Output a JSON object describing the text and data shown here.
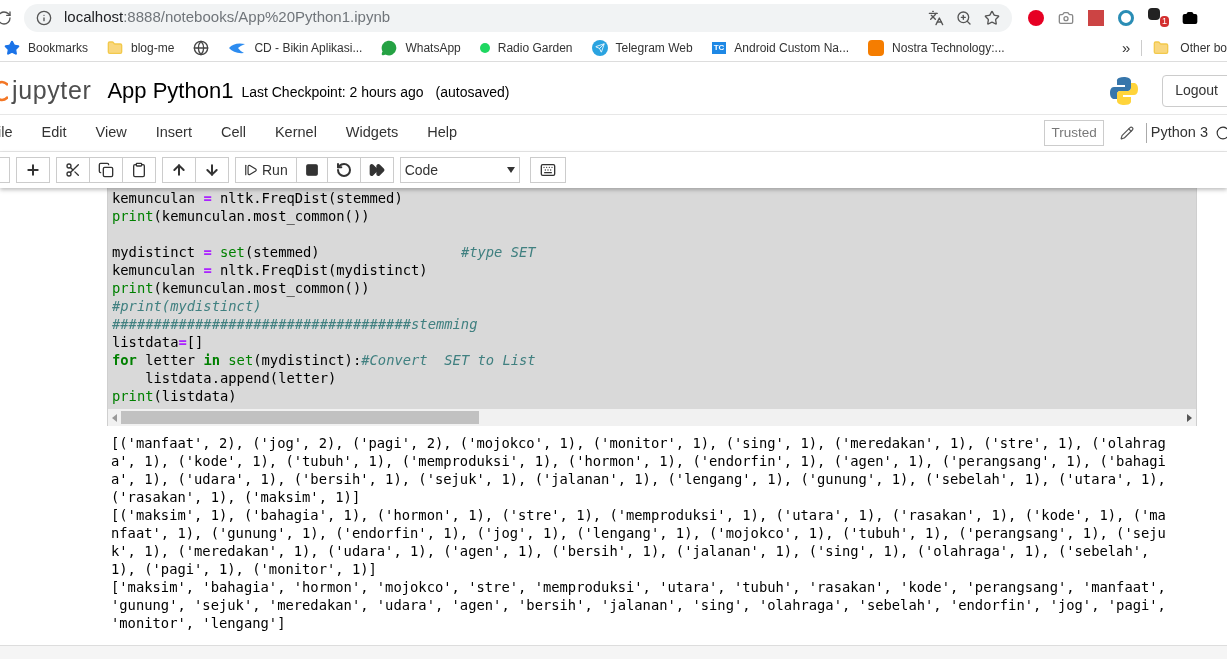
{
  "browser": {
    "url_host": "localhost",
    "url_path": ":8888/notebooks/App%20Python1.ipynb",
    "extension_badge": "1",
    "bookmarks": [
      {
        "label": "Bookmarks",
        "kind": "star"
      },
      {
        "label": "blog-me",
        "kind": "folder"
      },
      {
        "kind": "globe"
      },
      {
        "label": "CD - Bikin Aplikasi...",
        "kind": "bird"
      },
      {
        "label": "WhatsApp",
        "kind": "whatsapp"
      },
      {
        "label": "Radio Garden",
        "kind": "dot"
      },
      {
        "label": "Telegram Web",
        "kind": "telegram"
      },
      {
        "label": "Android Custom Na...",
        "kind": "tc",
        "icon_text": "TC"
      },
      {
        "label": "Nostra Technology:...",
        "kind": "blogger"
      }
    ],
    "more": "»",
    "other_folder": "Other bo"
  },
  "header": {
    "logo": "jupyter",
    "notebook_name": "App Python1",
    "checkpoint": "Last Checkpoint: 2 hours ago",
    "autosave": "(autosaved)",
    "logout": "Logout"
  },
  "menu": [
    "ile",
    "Edit",
    "View",
    "Insert",
    "Cell",
    "Kernel",
    "Widgets",
    "Help"
  ],
  "trusted": "Trusted",
  "kernel": "Python 3",
  "toolbar": {
    "run": "Run",
    "cell_type": "Code"
  },
  "cell": {
    "selected": true,
    "lines": [
      [
        {
          "kind": "plain",
          "text": "kemunculan "
        },
        {
          "kind": "op",
          "text": "="
        },
        {
          "kind": "plain",
          "text": " nltk.FreqDist(stemmed)"
        }
      ],
      [
        {
          "kind": "builtin",
          "text": "print"
        },
        {
          "kind": "plain",
          "text": "(kemunculan.most_common())"
        }
      ],
      [
        {
          "kind": "blank"
        }
      ],
      [
        {
          "kind": "plain",
          "text": "mydistinct "
        },
        {
          "kind": "op",
          "text": "="
        },
        {
          "kind": "builtin",
          "text": " set"
        },
        {
          "kind": "plain",
          "text": "(stemmed)                 "
        },
        {
          "kind": "comment",
          "text": "#type SET"
        }
      ],
      [
        {
          "kind": "plain",
          "text": "kemunculan "
        },
        {
          "kind": "op",
          "text": "="
        },
        {
          "kind": "plain",
          "text": " nltk.FreqDist(mydistinct)"
        }
      ],
      [
        {
          "kind": "builtin",
          "text": "print"
        },
        {
          "kind": "plain",
          "text": "(kemunculan.most_common())"
        }
      ],
      [
        {
          "kind": "comment",
          "text": "#print(mydistinct)"
        }
      ],
      [
        {
          "kind": "comment",
          "text": "####################################stemming"
        }
      ],
      [
        {
          "kind": "plain",
          "text": "listdata"
        },
        {
          "kind": "op",
          "text": "="
        },
        {
          "kind": "plain",
          "text": "[]"
        }
      ],
      [
        {
          "kind": "keyword",
          "text": "for"
        },
        {
          "kind": "plain",
          "text": " letter "
        },
        {
          "kind": "keyword",
          "text": "in"
        },
        {
          "kind": "builtin",
          "text": " set"
        },
        {
          "kind": "plain",
          "text": "(mydistinct):"
        },
        {
          "kind": "comment",
          "text": "#Convert  SET to List"
        }
      ],
      [
        {
          "kind": "plain",
          "text": "    listdata.append(letter)"
        }
      ],
      [
        {
          "kind": "builtin",
          "text": "print"
        },
        {
          "kind": "plain",
          "text": "(listdata)"
        }
      ]
    ]
  },
  "output": [
    "[('manfaat', 2), ('jog', 2), ('pagi', 2), ('mojokco', 1), ('monitor', 1), ('sing', 1), ('meredakan', 1), ('stre', 1), ('olahrag",
    "a', 1), ('kode', 1), ('tubuh', 1), ('memproduksi', 1), ('hormon', 1), ('endorfin', 1), ('agen', 1), ('perangsang', 1), ('bahagi",
    "a', 1), ('udara', 1), ('bersih', 1), ('sejuk', 1), ('jalanan', 1), ('lengang', 1), ('gunung', 1), ('sebelah', 1), ('utara', 1),",
    "('rasakan', 1), ('maksim', 1)]",
    "[('maksim', 1), ('bahagia', 1), ('hormon', 1), ('stre', 1), ('memproduksi', 1), ('utara', 1), ('rasakan', 1), ('kode', 1), ('ma",
    "nfaat', 1), ('gunung', 1), ('endorfin', 1), ('jog', 1), ('lengang', 1), ('mojokco', 1), ('tubuh', 1), ('perangsang', 1), ('seju",
    "k', 1), ('meredakan', 1), ('udara', 1), ('agen', 1), ('bersih', 1), ('jalanan', 1), ('sing', 1), ('olahraga', 1), ('sebelah',",
    "1), ('pagi', 1), ('monitor', 1)]",
    "['maksim', 'bahagia', 'hormon', 'mojokco', 'stre', 'memproduksi', 'utara', 'tubuh', 'rasakan', 'kode', 'perangsang', 'manfaat',",
    "'gunung', 'sejuk', 'meredakan', 'udara', 'agen', 'bersih', 'jalanan', 'sing', 'olahraga', 'sebelah', 'endorfin', 'jog', 'pagi',",
    "'monitor', 'lengang']"
  ]
}
